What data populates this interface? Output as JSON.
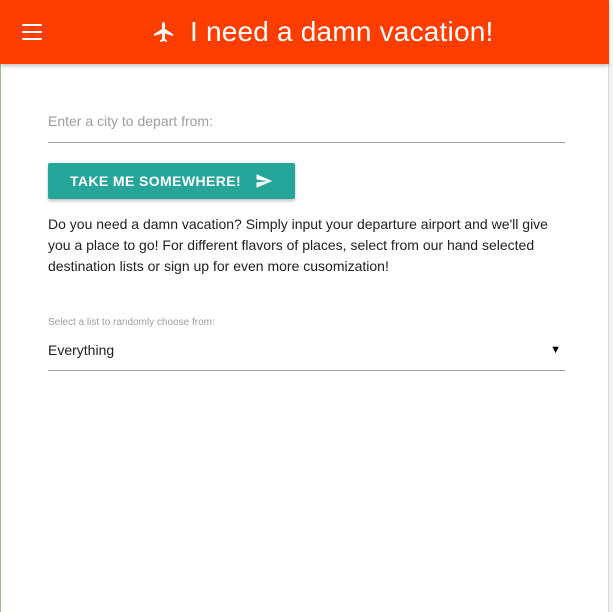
{
  "header": {
    "title": "I need a damn vacation!",
    "background_color": "#ff3d00",
    "menu_icon": "hamburger-menu-icon",
    "title_icon": "airplane-icon"
  },
  "search": {
    "placeholder": "Enter a city to depart from:",
    "value": ""
  },
  "go_button": {
    "label": "TAKE ME SOMEWHERE!",
    "icon": "send-icon",
    "color": "#26a69a"
  },
  "description": "Do you need a damn vacation? Simply input your departure airport and we'll give you a place to go! For different flavors of places, select from our hand selected destination lists or sign up for even more cusomization!",
  "list_select": {
    "label": "Select a list to randomly choose from:",
    "selected": "Everything",
    "arrow": "▼"
  }
}
